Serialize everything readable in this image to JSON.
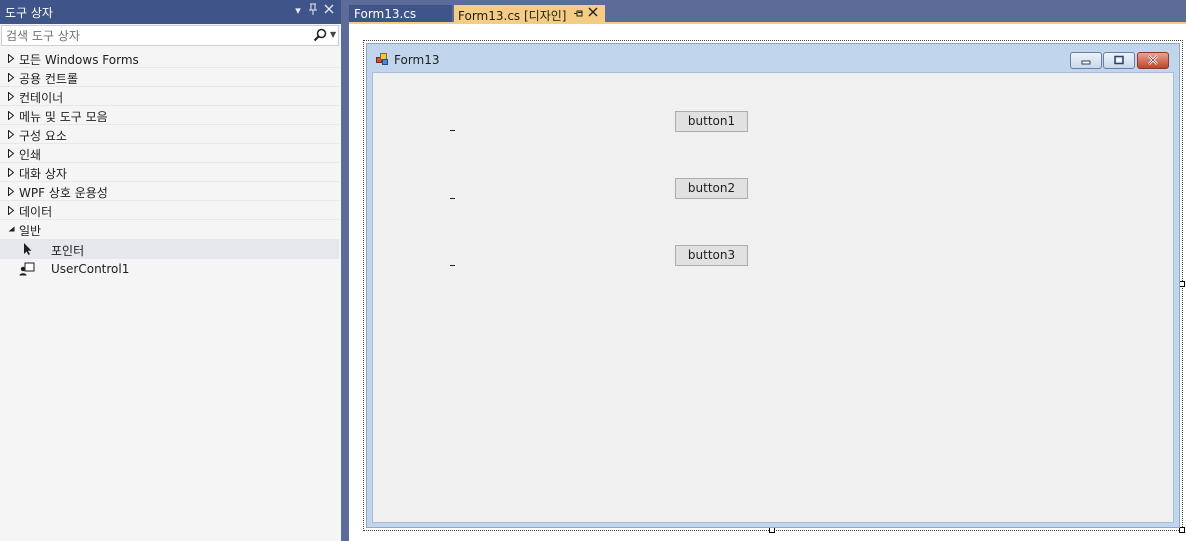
{
  "toolbox": {
    "title": "도구 상자",
    "search_placeholder": "검색 도구 상자",
    "categories": [
      {
        "label": "모든 Windows Forms",
        "expanded": false
      },
      {
        "label": "공용 컨트롤",
        "expanded": false
      },
      {
        "label": "컨테이너",
        "expanded": false
      },
      {
        "label": "메뉴 및 도구 모음",
        "expanded": false
      },
      {
        "label": "구성 요소",
        "expanded": false
      },
      {
        "label": "인쇄",
        "expanded": false
      },
      {
        "label": "대화 상자",
        "expanded": false
      },
      {
        "label": "WPF 상호 운용성",
        "expanded": false
      },
      {
        "label": "데이터",
        "expanded": false
      },
      {
        "label": "일반",
        "expanded": true
      }
    ],
    "general_items": [
      {
        "label": "포인터",
        "icon": "pointer-arrow-icon",
        "selected": true
      },
      {
        "label": "UserControl1",
        "icon": "user-control-icon",
        "selected": false
      }
    ]
  },
  "tabs": [
    {
      "label": "Form13.cs",
      "active": false
    },
    {
      "label": "Form13.cs [디자인]",
      "active": true
    }
  ],
  "form": {
    "title": "Form13",
    "buttons": [
      "button1",
      "button2",
      "button3"
    ]
  },
  "colors": {
    "header_bg": "#3f5488",
    "active_tab": "#f5cc84",
    "frame_bg": "#5d6b99",
    "form_client": "#f0f0f0"
  }
}
